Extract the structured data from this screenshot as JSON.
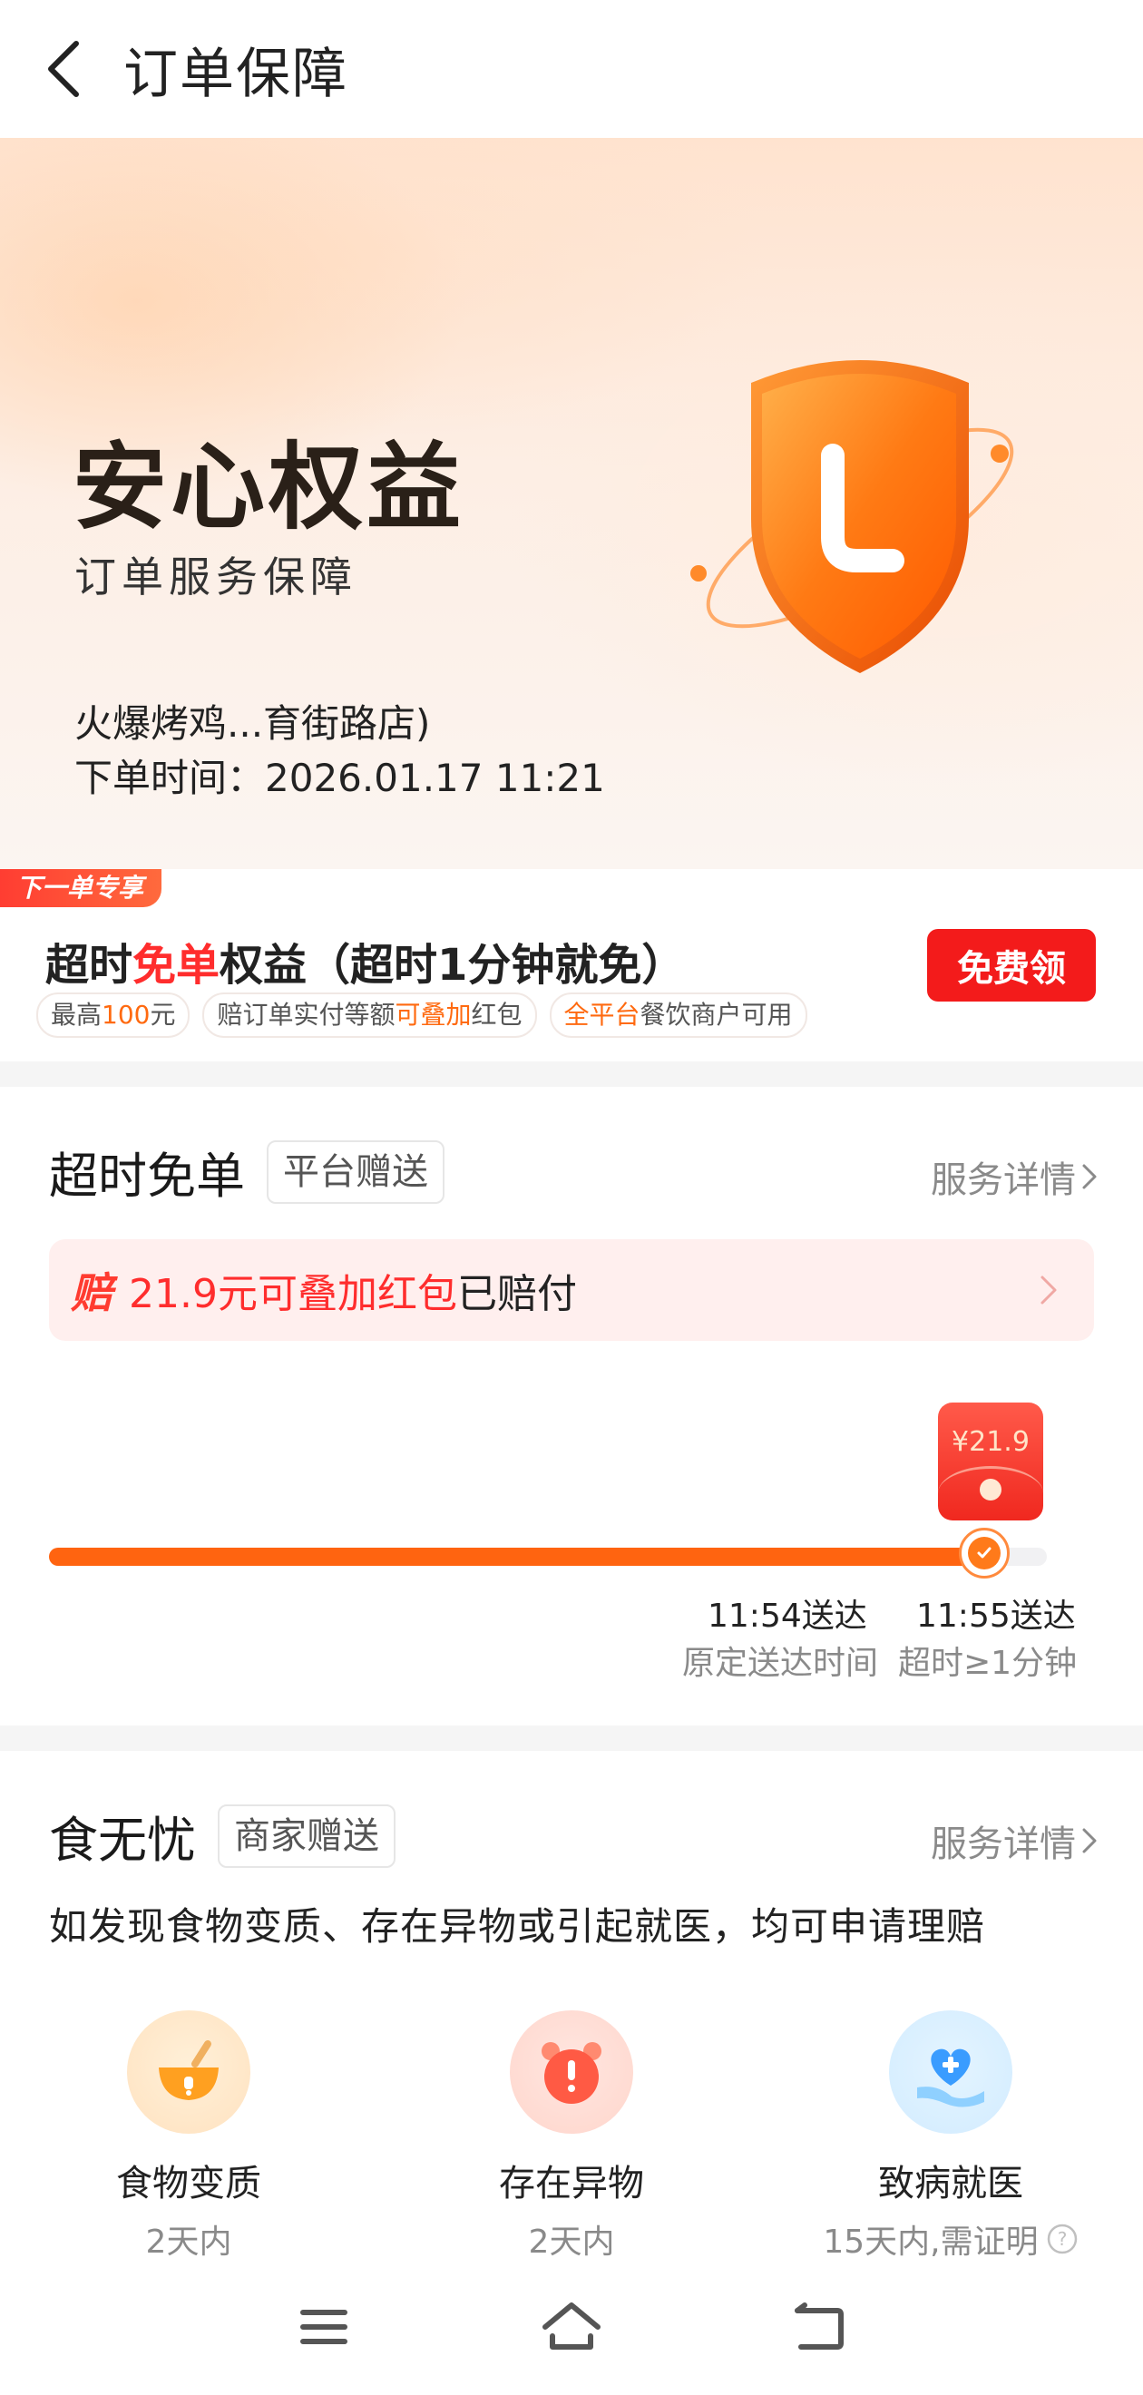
{
  "topbar": {
    "title": "订单保障"
  },
  "hero": {
    "title": "安心权益",
    "subtitle": "订单服务保障",
    "store": "火爆烤鸡...育街路店)",
    "order_time_label": "下单时间：",
    "order_time_value": "2026.01.17 11:21"
  },
  "promo": {
    "tag": "下一单专享",
    "title_prefix": "超时",
    "title_highlight": "免单",
    "title_suffix": "权益（超时1分钟就免）",
    "chips": [
      {
        "pre": "最高",
        "highlight": "100",
        "post": "元"
      },
      {
        "pre": "赔订单实付等额",
        "highlight": "可叠加",
        "post": "红包"
      },
      {
        "pre": "",
        "highlight": "全平台",
        "post": "餐饮商户可用"
      }
    ],
    "button": "免费领"
  },
  "overtime": {
    "title": "超时免单",
    "badge": "平台赠送",
    "link": "服务详情",
    "pay_icon": "赔",
    "pay_highlight": "21.9元可叠加红包",
    "pay_status": "已赔付",
    "redpacket_amount": "¥21.9",
    "progress": 0.96,
    "times": [
      {
        "time": "11:54送达",
        "label": "原定送达时间"
      },
      {
        "time": "11:55送达",
        "label": "超时≥1分钟"
      }
    ]
  },
  "food": {
    "title": "食无忧",
    "badge": "商家赠送",
    "link": "服务详情",
    "description": "如发现食物变质、存在异物或引起就医，均可申请理赔",
    "features": [
      {
        "icon": "spoiled-food-icon",
        "title": "食物变质",
        "sub": "2天内"
      },
      {
        "icon": "foreign-object-icon",
        "title": "存在异物",
        "sub": "2天内"
      },
      {
        "icon": "medical-heart-icon",
        "title": "致病就医",
        "sub": "15天内,需证明"
      }
    ]
  },
  "colors": {
    "accent": "#ff6410",
    "red": "#ff2d2d"
  }
}
